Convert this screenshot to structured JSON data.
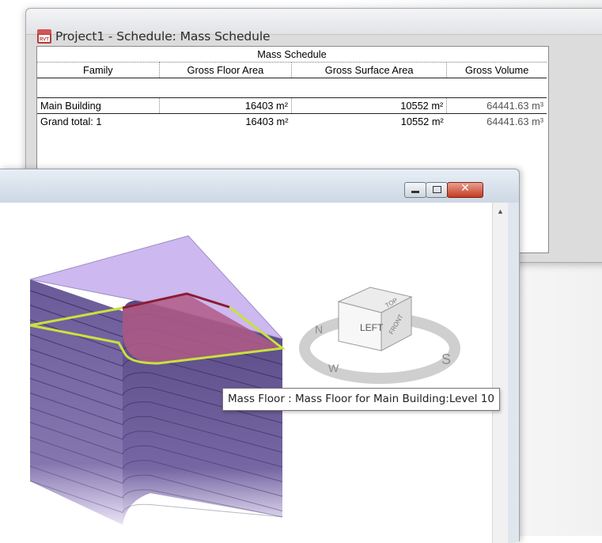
{
  "schedule_window": {
    "title": "Project1 - Schedule: Mass Schedule",
    "table_title": "Mass Schedule",
    "columns": [
      "Family",
      "Gross Floor Area",
      "Gross Surface Area",
      "Gross Volume"
    ],
    "rows": [
      {
        "family": "Main Building",
        "gross_floor_area": "16403 m²",
        "gross_surface_area": "10552 m²",
        "gross_volume": "64441.63 m³"
      },
      {
        "family": "Grand total: 1",
        "gross_floor_area": "16403 m²",
        "gross_surface_area": "10552 m²",
        "gross_volume": "64441.63 m³"
      }
    ]
  },
  "view_window": {
    "viewcube_face": "LEFT",
    "viewcube_top": "TOP",
    "viewcube_front": "FRONT",
    "compass": {
      "n": "N",
      "s": "S",
      "w": "W"
    },
    "tooltip": "Mass Floor : Mass Floor for Main Building:Level 10",
    "buttons": {
      "close": "✕"
    }
  },
  "colors": {
    "mass_fill": "#6c5b99",
    "mass_top": "#cbb6ee",
    "highlight_floor": "#9f3f6b",
    "edge_highlight": "#c8e23c"
  }
}
